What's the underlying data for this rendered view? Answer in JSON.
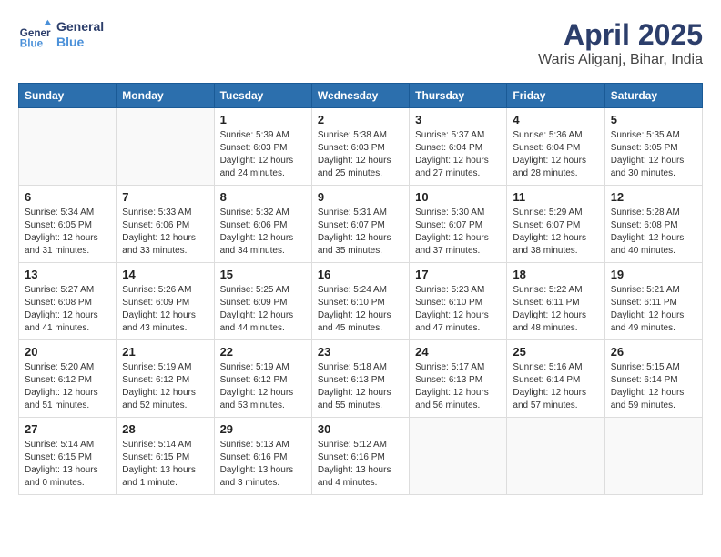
{
  "logo": {
    "line1": "General",
    "line2": "Blue"
  },
  "title": "April 2025",
  "location": "Waris Aliganj, Bihar, India",
  "days_of_week": [
    "Sunday",
    "Monday",
    "Tuesday",
    "Wednesday",
    "Thursday",
    "Friday",
    "Saturday"
  ],
  "weeks": [
    [
      {
        "day": "",
        "info": ""
      },
      {
        "day": "",
        "info": ""
      },
      {
        "day": "1",
        "info": "Sunrise: 5:39 AM\nSunset: 6:03 PM\nDaylight: 12 hours\nand 24 minutes."
      },
      {
        "day": "2",
        "info": "Sunrise: 5:38 AM\nSunset: 6:03 PM\nDaylight: 12 hours\nand 25 minutes."
      },
      {
        "day": "3",
        "info": "Sunrise: 5:37 AM\nSunset: 6:04 PM\nDaylight: 12 hours\nand 27 minutes."
      },
      {
        "day": "4",
        "info": "Sunrise: 5:36 AM\nSunset: 6:04 PM\nDaylight: 12 hours\nand 28 minutes."
      },
      {
        "day": "5",
        "info": "Sunrise: 5:35 AM\nSunset: 6:05 PM\nDaylight: 12 hours\nand 30 minutes."
      }
    ],
    [
      {
        "day": "6",
        "info": "Sunrise: 5:34 AM\nSunset: 6:05 PM\nDaylight: 12 hours\nand 31 minutes."
      },
      {
        "day": "7",
        "info": "Sunrise: 5:33 AM\nSunset: 6:06 PM\nDaylight: 12 hours\nand 33 minutes."
      },
      {
        "day": "8",
        "info": "Sunrise: 5:32 AM\nSunset: 6:06 PM\nDaylight: 12 hours\nand 34 minutes."
      },
      {
        "day": "9",
        "info": "Sunrise: 5:31 AM\nSunset: 6:07 PM\nDaylight: 12 hours\nand 35 minutes."
      },
      {
        "day": "10",
        "info": "Sunrise: 5:30 AM\nSunset: 6:07 PM\nDaylight: 12 hours\nand 37 minutes."
      },
      {
        "day": "11",
        "info": "Sunrise: 5:29 AM\nSunset: 6:07 PM\nDaylight: 12 hours\nand 38 minutes."
      },
      {
        "day": "12",
        "info": "Sunrise: 5:28 AM\nSunset: 6:08 PM\nDaylight: 12 hours\nand 40 minutes."
      }
    ],
    [
      {
        "day": "13",
        "info": "Sunrise: 5:27 AM\nSunset: 6:08 PM\nDaylight: 12 hours\nand 41 minutes."
      },
      {
        "day": "14",
        "info": "Sunrise: 5:26 AM\nSunset: 6:09 PM\nDaylight: 12 hours\nand 43 minutes."
      },
      {
        "day": "15",
        "info": "Sunrise: 5:25 AM\nSunset: 6:09 PM\nDaylight: 12 hours\nand 44 minutes."
      },
      {
        "day": "16",
        "info": "Sunrise: 5:24 AM\nSunset: 6:10 PM\nDaylight: 12 hours\nand 45 minutes."
      },
      {
        "day": "17",
        "info": "Sunrise: 5:23 AM\nSunset: 6:10 PM\nDaylight: 12 hours\nand 47 minutes."
      },
      {
        "day": "18",
        "info": "Sunrise: 5:22 AM\nSunset: 6:11 PM\nDaylight: 12 hours\nand 48 minutes."
      },
      {
        "day": "19",
        "info": "Sunrise: 5:21 AM\nSunset: 6:11 PM\nDaylight: 12 hours\nand 49 minutes."
      }
    ],
    [
      {
        "day": "20",
        "info": "Sunrise: 5:20 AM\nSunset: 6:12 PM\nDaylight: 12 hours\nand 51 minutes."
      },
      {
        "day": "21",
        "info": "Sunrise: 5:19 AM\nSunset: 6:12 PM\nDaylight: 12 hours\nand 52 minutes."
      },
      {
        "day": "22",
        "info": "Sunrise: 5:19 AM\nSunset: 6:12 PM\nDaylight: 12 hours\nand 53 minutes."
      },
      {
        "day": "23",
        "info": "Sunrise: 5:18 AM\nSunset: 6:13 PM\nDaylight: 12 hours\nand 55 minutes."
      },
      {
        "day": "24",
        "info": "Sunrise: 5:17 AM\nSunset: 6:13 PM\nDaylight: 12 hours\nand 56 minutes."
      },
      {
        "day": "25",
        "info": "Sunrise: 5:16 AM\nSunset: 6:14 PM\nDaylight: 12 hours\nand 57 minutes."
      },
      {
        "day": "26",
        "info": "Sunrise: 5:15 AM\nSunset: 6:14 PM\nDaylight: 12 hours\nand 59 minutes."
      }
    ],
    [
      {
        "day": "27",
        "info": "Sunrise: 5:14 AM\nSunset: 6:15 PM\nDaylight: 13 hours\nand 0 minutes."
      },
      {
        "day": "28",
        "info": "Sunrise: 5:14 AM\nSunset: 6:15 PM\nDaylight: 13 hours\nand 1 minute."
      },
      {
        "day": "29",
        "info": "Sunrise: 5:13 AM\nSunset: 6:16 PM\nDaylight: 13 hours\nand 3 minutes."
      },
      {
        "day": "30",
        "info": "Sunrise: 5:12 AM\nSunset: 6:16 PM\nDaylight: 13 hours\nand 4 minutes."
      },
      {
        "day": "",
        "info": ""
      },
      {
        "day": "",
        "info": ""
      },
      {
        "day": "",
        "info": ""
      }
    ]
  ]
}
